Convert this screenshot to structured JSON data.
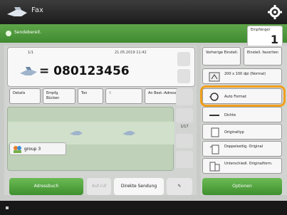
{
  "header": {
    "title": "Fax"
  },
  "status": {
    "text": "Sendebereit."
  },
  "recipients": {
    "label": "Empfänger",
    "count": "1"
  },
  "destination": {
    "sequence": "1/1",
    "datetime": "21.05.2019 11:42",
    "number": "= 080123456"
  },
  "options": {
    "details": "Details",
    "recipient_check": "Empfg. Bücken",
    "tone": "Ton",
    "r": "R",
    "address_book_label": "An Best.-Adressbuch"
  },
  "list": {
    "group": "group 3",
    "page": "1/17"
  },
  "bottom": {
    "address_book": "Adressbuch",
    "call_up": "Auf-ruf",
    "direct_send": "Direkte Sendung",
    "options": "Optionen"
  },
  "settings": {
    "previous": "Vorherige Einstell.",
    "favorites": "Einstell. favoriten",
    "resolution": "200 x 100 dpi (Normal)",
    "auto_format": "Auto Format",
    "density": "Dichte",
    "original_type": "Originaltyp",
    "duplex": "Doppelseitig. Original",
    "mixed": "Unterschiedl. Originalform."
  },
  "colors": {
    "accent_green": "#4a9a38",
    "highlight": "#f0a01e",
    "titlebar": "#2a2a2a"
  }
}
